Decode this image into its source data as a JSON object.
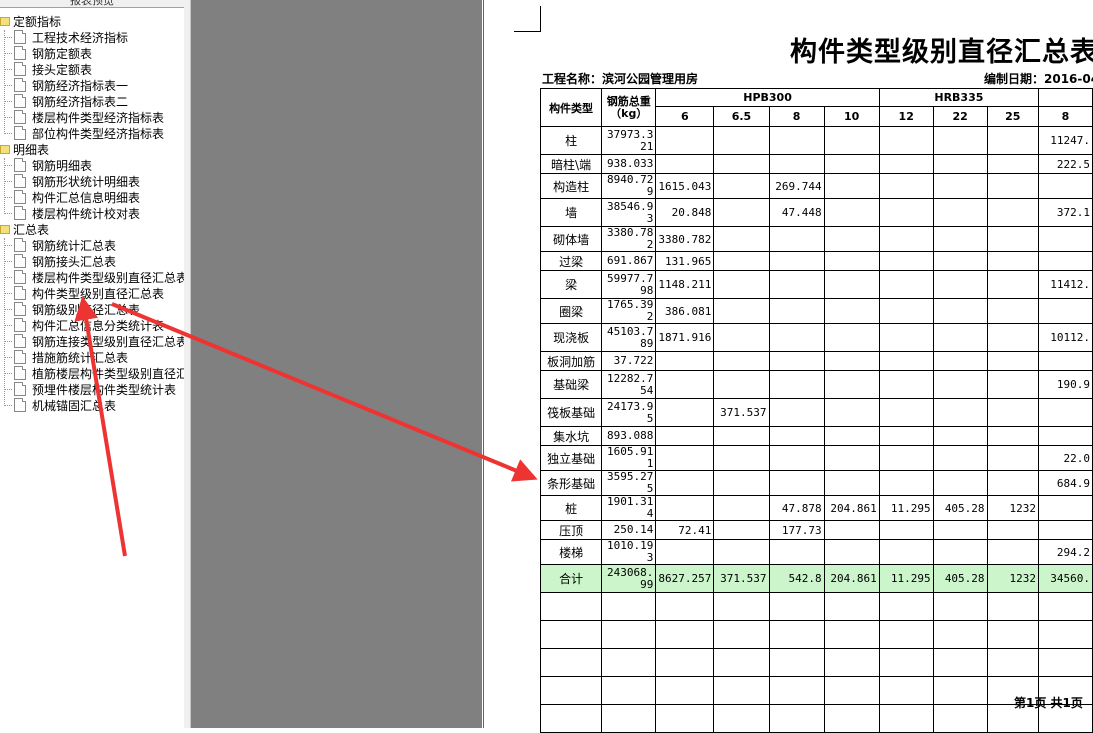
{
  "tree": {
    "header": "报表预览",
    "groups": [
      {
        "label": "定额指标",
        "items": [
          "工程技术经济指标",
          "钢筋定额表",
          "接头定额表",
          "钢筋经济指标表一",
          "钢筋经济指标表二",
          "楼层构件类型经济指标表",
          "部位构件类型经济指标表"
        ]
      },
      {
        "label": "明细表",
        "items": [
          "钢筋明细表",
          "钢筋形状统计明细表",
          "构件汇总信息明细表",
          "楼层构件统计校对表"
        ]
      },
      {
        "label": "汇总表",
        "items": [
          "钢筋统计汇总表",
          "钢筋接头汇总表",
          "楼层构件类型级别直径汇总表",
          "构件类型级别直径汇总表",
          "钢筋级别直径汇总表",
          "构件汇总信息分类统计表",
          "钢筋连接类型级别直径汇总表",
          "措施筋统计汇总表",
          "植筋楼层构件类型级别直径汇",
          "预埋件楼层构件类型统计表",
          "机械锚固汇总表"
        ]
      }
    ]
  },
  "report": {
    "title": "构件类型级别直径汇总表",
    "project_label": "工程名称：滨河公园管理用房",
    "date_label": "编制日期：2016-04",
    "footer": "第1页 共1页",
    "header": {
      "col_type": "构件类型",
      "col_total": "钢筋总重（kg）",
      "grade_hpb": "HPB300",
      "grade_hrb": "HRB335",
      "diameters": [
        "6",
        "6.5",
        "8",
        "10",
        "12",
        "22",
        "25",
        "8"
      ]
    },
    "rows": [
      [
        "柱",
        "37973.321",
        "",
        "",
        "",
        "",
        "",
        "",
        "",
        "11247."
      ],
      [
        "暗柱\\端",
        "938.033",
        "",
        "",
        "",
        "",
        "",
        "",
        "",
        "222.5"
      ],
      [
        "构造柱",
        "8940.729",
        "1615.043",
        "",
        "269.744",
        "",
        "",
        "",
        "",
        ""
      ],
      [
        "墙",
        "38546.93",
        "20.848",
        "",
        "47.448",
        "",
        "",
        "",
        "",
        "372.1"
      ],
      [
        "砌体墙",
        "3380.782",
        "3380.782",
        "",
        "",
        "",
        "",
        "",
        "",
        ""
      ],
      [
        "过梁",
        "691.867",
        "131.965",
        "",
        "",
        "",
        "",
        "",
        "",
        ""
      ],
      [
        "梁",
        "59977.798",
        "1148.211",
        "",
        "",
        "",
        "",
        "",
        "",
        "11412."
      ],
      [
        "圈梁",
        "1765.392",
        "386.081",
        "",
        "",
        "",
        "",
        "",
        "",
        ""
      ],
      [
        "现浇板",
        "45103.789",
        "1871.916",
        "",
        "",
        "",
        "",
        "",
        "",
        "10112."
      ],
      [
        "板洞加筋",
        "37.722",
        "",
        "",
        "",
        "",
        "",
        "",
        "",
        ""
      ],
      [
        "基础梁",
        "12282.754",
        "",
        "",
        "",
        "",
        "",
        "",
        "",
        "190.9"
      ],
      [
        "筏板基础",
        "24173.95",
        "",
        "371.537",
        "",
        "",
        "",
        "",
        "",
        ""
      ],
      [
        "集水坑",
        "893.088",
        "",
        "",
        "",
        "",
        "",
        "",
        "",
        ""
      ],
      [
        "独立基础",
        "1605.911",
        "",
        "",
        "",
        "",
        "",
        "",
        "",
        "22.0"
      ],
      [
        "条形基础",
        "3595.275",
        "",
        "",
        "",
        "",
        "",
        "",
        "",
        "684.9"
      ],
      [
        "桩",
        "1901.314",
        "",
        "",
        "47.878",
        "204.861",
        "11.295",
        "405.28",
        "1232",
        ""
      ],
      [
        "压顶",
        "250.14",
        "72.41",
        "",
        "177.73",
        "",
        "",
        "",
        "",
        ""
      ],
      [
        "楼梯",
        "1010.193",
        "",
        "",
        "",
        "",
        "",
        "",
        "",
        "294.2"
      ],
      [
        "合计",
        "243068.99",
        "8627.257",
        "371.537",
        "542.8",
        "204.861",
        "11.295",
        "405.28",
        "1232",
        "34560."
      ]
    ],
    "empty_rows": 5
  },
  "colors": {
    "total_row": "#ccf5cc",
    "arrow": "#ee3333",
    "gray_area": "#808080"
  }
}
